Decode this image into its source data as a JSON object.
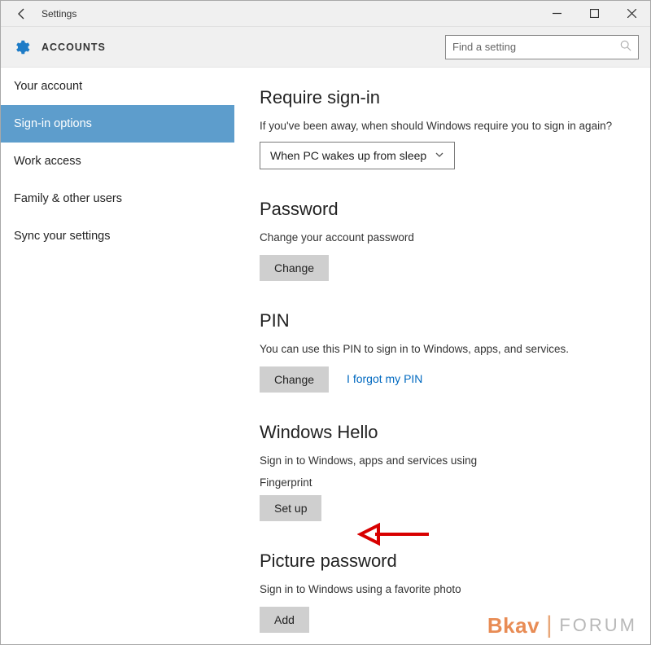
{
  "window": {
    "title": "Settings",
    "category": "ACCOUNTS"
  },
  "search": {
    "placeholder": "Find a setting"
  },
  "sidebar": {
    "items": [
      {
        "label": "Your account",
        "active": false
      },
      {
        "label": "Sign-in options",
        "active": true
      },
      {
        "label": "Work access",
        "active": false
      },
      {
        "label": "Family & other users",
        "active": false
      },
      {
        "label": "Sync your settings",
        "active": false
      }
    ]
  },
  "sections": {
    "require": {
      "title": "Require sign-in",
      "desc": "If you've been away, when should Windows require you to sign in again?",
      "select_value": "When PC wakes up from sleep"
    },
    "password": {
      "title": "Password",
      "desc": "Change your account password",
      "button": "Change"
    },
    "pin": {
      "title": "PIN",
      "desc": "You can use this PIN to sign in to Windows, apps, and services.",
      "button": "Change",
      "link": "I forgot my PIN"
    },
    "hello": {
      "title": "Windows Hello",
      "desc": "Sign in to Windows, apps and services using",
      "sub": "Fingerprint",
      "button": "Set up"
    },
    "picture": {
      "title": "Picture password",
      "desc": "Sign in to Windows using a favorite photo",
      "button": "Add"
    }
  },
  "watermark": {
    "brand": "Bkav",
    "forum": "FORUM"
  }
}
